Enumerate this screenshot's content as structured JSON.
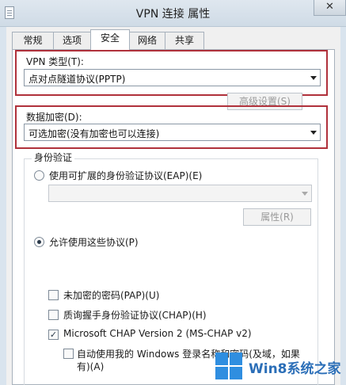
{
  "window": {
    "title": "VPN 连接 属性",
    "close_glyph": "✕"
  },
  "tabs": [
    {
      "label": "常规"
    },
    {
      "label": "选项"
    },
    {
      "label": "安全"
    },
    {
      "label": "网络"
    },
    {
      "label": "共享"
    }
  ],
  "active_tab": "安全",
  "vpn_type": {
    "label": "VPN 类型(T):",
    "value": "点对点隧道协议(PPTP)"
  },
  "advanced_button": "高级设置(S)",
  "encryption": {
    "label": "数据加密(D):",
    "value": "可选加密(没有加密也可以连接)"
  },
  "auth": {
    "group_title": "身份验证",
    "eap_radio": "使用可扩展的身份验证协议(EAP)(E)",
    "eap_select_value": "",
    "properties_button": "属性(R)",
    "allow_radio": "允许使用这些协议(P)",
    "protocols": [
      {
        "label": "未加密的密码(PAP)(U)",
        "checked": false
      },
      {
        "label": "质询握手身份验证协议(CHAP)(H)",
        "checked": false
      },
      {
        "label": "Microsoft CHAP Version 2 (MS-CHAP v2)",
        "checked": true
      }
    ],
    "auto_windows_line1": "自动使用我的 Windows 登录名称和密码(及域，如果",
    "auto_windows_line2": "有)(A)"
  },
  "watermark": {
    "text": "Win8系统之家",
    "color": "#2f8ee0"
  },
  "colors": {
    "highlight_box": "#b0313b"
  }
}
